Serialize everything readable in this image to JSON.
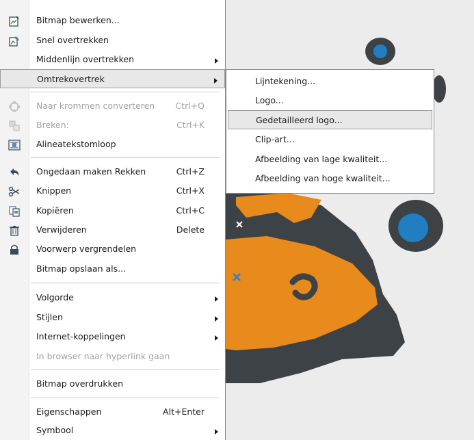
{
  "menu": {
    "items": [
      {
        "label": "Bitmap bewerken...",
        "icon": "bitmap-edit-icon",
        "enabled": true
      },
      {
        "label": "Snel overtrekken",
        "icon": "quick-trace-icon",
        "enabled": true
      },
      {
        "label": "Middenlijn overtrekken",
        "submenu": true,
        "enabled": true
      },
      {
        "label": "Omtrekovertrek",
        "submenu": true,
        "enabled": true,
        "highlighted": true
      },
      {
        "label": "Naar krommen converteren",
        "shortcut": "Ctrl+Q",
        "icon": "convert-curves-icon",
        "enabled": false
      },
      {
        "label": "Breken:",
        "shortcut": "Ctrl+K",
        "icon": "break-apart-icon",
        "enabled": false
      },
      {
        "label": "Alineatekstomloop",
        "icon": "text-wrap-icon",
        "enabled": true
      },
      {
        "label": "Ongedaan maken Rekken",
        "shortcut": "Ctrl+Z",
        "icon": "undo-icon",
        "enabled": true
      },
      {
        "label": "Knippen",
        "shortcut": "Ctrl+X",
        "icon": "scissors-icon",
        "enabled": true
      },
      {
        "label": "Kopiëren",
        "shortcut": "Ctrl+C",
        "icon": "copy-icon",
        "enabled": true
      },
      {
        "label": "Verwijderen",
        "shortcut": "Delete",
        "icon": "trash-icon",
        "enabled": true
      },
      {
        "label": "Voorwerp vergrendelen",
        "icon": "lock-icon",
        "enabled": true
      },
      {
        "label": "Bitmap opslaan als...",
        "enabled": true
      },
      {
        "label": "Volgorde",
        "submenu": true,
        "enabled": true
      },
      {
        "label": "Stijlen",
        "submenu": true,
        "enabled": true
      },
      {
        "label": "Internet-koppelingen",
        "submenu": true,
        "enabled": true
      },
      {
        "label": "In browser naar hyperlink gaan",
        "enabled": false
      },
      {
        "label": "Bitmap overdrukken",
        "enabled": true
      },
      {
        "label": "Eigenschappen",
        "shortcut": "Alt+Enter",
        "enabled": true
      },
      {
        "label": "Symbool",
        "submenu": true,
        "enabled": true
      }
    ]
  },
  "submenu": {
    "items": [
      {
        "label": "Lijntekening..."
      },
      {
        "label": "Logo..."
      },
      {
        "label": "Gedetailleerd logo...",
        "highlighted": true
      },
      {
        "label": "Clip-art..."
      },
      {
        "label": "Afbeelding van lage kwaliteit..."
      },
      {
        "label": "Afbeelding van hoge kwaliteit..."
      }
    ]
  },
  "colors": {
    "orange": "#e88a1c",
    "blue": "#1f7fc0",
    "outline": "#3d4247",
    "selection_handle": "#2a7fd4"
  }
}
